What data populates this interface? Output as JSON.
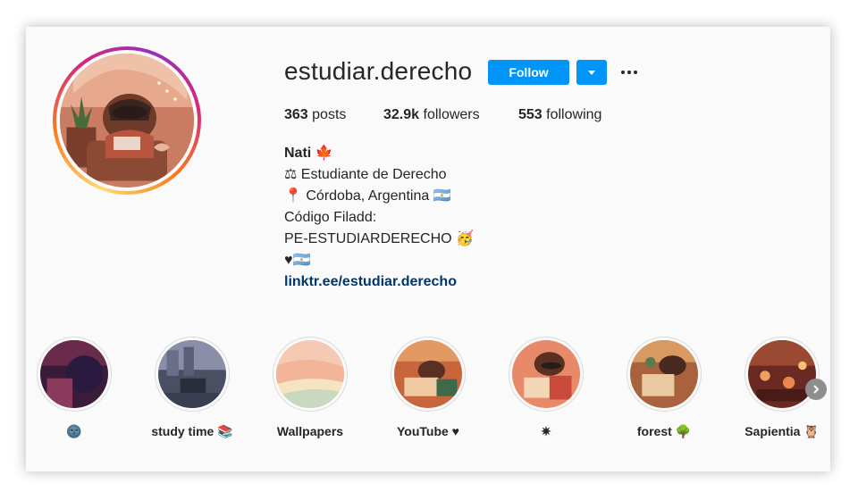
{
  "profile": {
    "username": "estudiar.derecho",
    "follow_label": "Follow",
    "avatar_icon": "profile-photo-raccoon-reading",
    "stats": {
      "posts_count": "363",
      "posts_label": "posts",
      "followers_count": "32.9k",
      "followers_label": "followers",
      "following_count": "553",
      "following_label": "following"
    },
    "bio": {
      "name": "Nati 🍁",
      "lines": [
        "⚖ Estudiante de Derecho",
        "📍 Córdoba, Argentina 🇦🇷",
        "Código Filadd:",
        "PE-ESTUDIARDERECHO 🥳",
        "♥🇦🇷"
      ],
      "link": "linktr.ee/estudiar.derecho"
    }
  },
  "highlights": [
    {
      "label": "🌚"
    },
    {
      "label": "study time 📚"
    },
    {
      "label": "Wallpapers"
    },
    {
      "label": "YouTube ♥"
    },
    {
      "label": "✷"
    },
    {
      "label": "forest 🌳"
    },
    {
      "label": "Sapientia 🦉"
    }
  ],
  "colors": {
    "follow_button": "#0095f6",
    "link": "#00376b",
    "text": "#262626",
    "background": "#fafafa"
  }
}
